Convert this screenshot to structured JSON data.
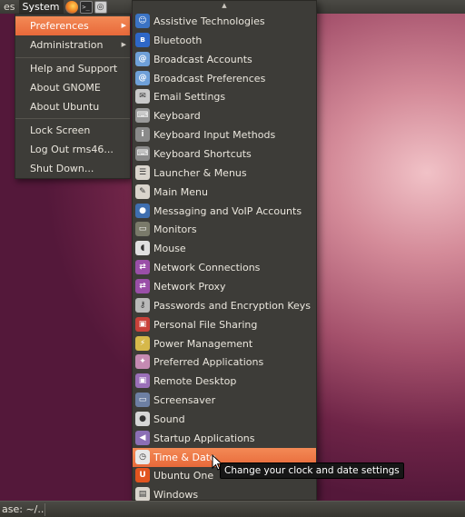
{
  "top_panel": {
    "menus": [
      "es",
      "System"
    ],
    "launchers": [
      {
        "name": "firefox-icon"
      },
      {
        "name": "terminal-icon"
      },
      {
        "name": "screenshot-icon"
      }
    ]
  },
  "system_menu": {
    "items": [
      {
        "label": "Preferences",
        "submenu": true,
        "highlighted": true
      },
      {
        "label": "Administration",
        "submenu": true
      },
      {
        "label": "Help and Support"
      },
      {
        "label": "About GNOME"
      },
      {
        "label": "About Ubuntu"
      },
      {
        "label": "Lock Screen"
      },
      {
        "label": "Log Out rms46..."
      },
      {
        "label": "Shut Down..."
      }
    ],
    "arrow": "▶"
  },
  "preferences_menu": {
    "scroll_arrow": "▲",
    "items": [
      {
        "label": "Assistive Technologies",
        "icon": "accessibility-icon",
        "color": "#3b73c4",
        "glyph": "☺"
      },
      {
        "label": "Bluetooth",
        "icon": "bluetooth-icon",
        "color": "#2e67c7",
        "glyph": "ʙ"
      },
      {
        "label": "Broadcast Accounts",
        "icon": "broadcast-accounts-icon",
        "color": "#6fa0d8",
        "glyph": "@"
      },
      {
        "label": "Broadcast Preferences",
        "icon": "broadcast-preferences-icon",
        "color": "#6fa0d8",
        "glyph": "@"
      },
      {
        "label": "Email Settings",
        "icon": "email-icon",
        "color": "#c9c9c9",
        "glyph": "✉"
      },
      {
        "label": "Keyboard",
        "icon": "keyboard-icon",
        "color": "#9a9a9a",
        "glyph": "⌨"
      },
      {
        "label": "Keyboard Input Methods",
        "icon": "input-methods-icon",
        "color": "#8a8a8a",
        "glyph": "i"
      },
      {
        "label": "Keyboard Shortcuts",
        "icon": "keyboard-shortcuts-icon",
        "color": "#8a8a8a",
        "glyph": "⌨"
      },
      {
        "label": "Launcher & Menus",
        "icon": "launcher-menus-icon",
        "color": "#d9d4cc",
        "glyph": "☰"
      },
      {
        "label": "Main Menu",
        "icon": "main-menu-icon",
        "color": "#d9d4cc",
        "glyph": "✎"
      },
      {
        "label": "Messaging and VoIP Accounts",
        "icon": "messaging-icon",
        "color": "#3f6fb0",
        "glyph": "●"
      },
      {
        "label": "Monitors",
        "icon": "monitor-icon",
        "color": "#7a7a6a",
        "glyph": "▭"
      },
      {
        "label": "Mouse",
        "icon": "mouse-icon",
        "color": "#e0e0e0",
        "glyph": "◖"
      },
      {
        "label": "Network Connections",
        "icon": "network-connections-icon",
        "color": "#9a4fa8",
        "glyph": "⇄"
      },
      {
        "label": "Network Proxy",
        "icon": "network-proxy-icon",
        "color": "#9a4fa8",
        "glyph": "⇄"
      },
      {
        "label": "Passwords and Encryption Keys",
        "icon": "key-icon",
        "color": "#b9b9b9",
        "glyph": "⚷"
      },
      {
        "label": "Personal File Sharing",
        "icon": "file-sharing-icon",
        "color": "#c9413a",
        "glyph": "▣"
      },
      {
        "label": "Power Management",
        "icon": "power-icon",
        "color": "#d6b84a",
        "glyph": "⚡"
      },
      {
        "label": "Preferred Applications",
        "icon": "preferred-apps-icon",
        "color": "#c58ab2",
        "glyph": "✦"
      },
      {
        "label": "Remote Desktop",
        "icon": "remote-desktop-icon",
        "color": "#9a6fb8",
        "glyph": "▣"
      },
      {
        "label": "Screensaver",
        "icon": "screensaver-icon",
        "color": "#6d7fa3",
        "glyph": "▭"
      },
      {
        "label": "Sound",
        "icon": "sound-icon",
        "color": "#d6d6d6",
        "glyph": "●"
      },
      {
        "label": "Startup Applications",
        "icon": "startup-icon",
        "color": "#8b6fb5",
        "glyph": "◀"
      },
      {
        "label": "Time & Date",
        "icon": "time-date-icon",
        "color": "#e8e8e8",
        "glyph": "◷",
        "highlighted": true
      },
      {
        "label": "Ubuntu One",
        "icon": "ubuntu-one-icon",
        "color": "#e2541f",
        "glyph": "U"
      },
      {
        "label": "Windows",
        "icon": "windows-icon",
        "color": "#d9d4cc",
        "glyph": "▤"
      }
    ]
  },
  "tooltip": {
    "text": "Change your clock and date settings"
  },
  "bottom_panel": {
    "taskbar_item": "ase: ~/..."
  },
  "colors": {
    "highlight": "#f07746",
    "menu_bg": "#3d3c38",
    "panel_bg": "#3f3e3a"
  }
}
